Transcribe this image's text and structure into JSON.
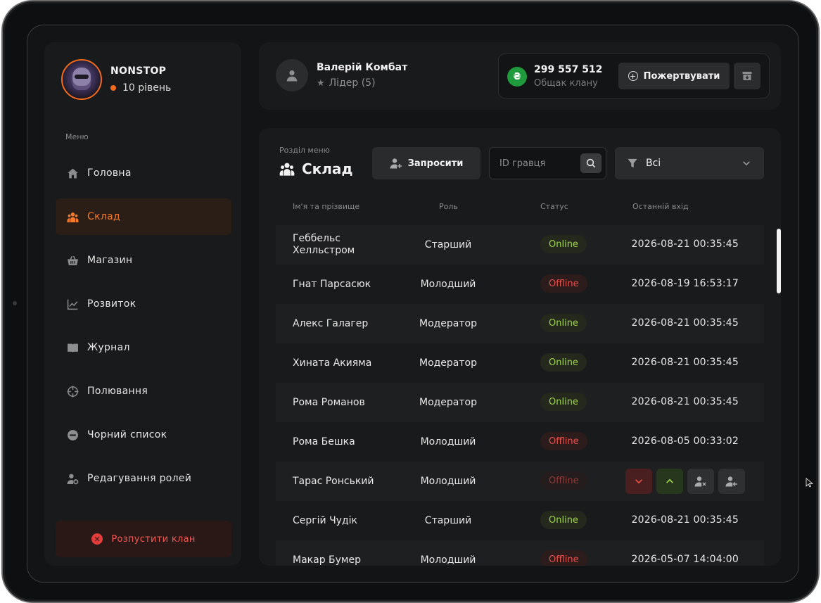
{
  "clan": {
    "name": "NONSTOP",
    "level": "10 рівень"
  },
  "sidebar": {
    "caption": "Меню",
    "items": [
      {
        "label": "Головна",
        "icon": "home-icon",
        "active": false
      },
      {
        "label": "Склад",
        "icon": "team-icon",
        "active": true
      },
      {
        "label": "Магазин",
        "icon": "basket-icon",
        "active": false
      },
      {
        "label": "Розвиток",
        "icon": "chart-line-icon",
        "active": false
      },
      {
        "label": "Журнал",
        "icon": "book-icon",
        "active": false
      },
      {
        "label": "Полювання",
        "icon": "crosshair-icon",
        "active": false
      },
      {
        "label": "Чорний список",
        "icon": "block-icon",
        "active": false
      },
      {
        "label": "Редагування ролей",
        "icon": "user-gear-icon",
        "active": false
      }
    ],
    "disband_label": "Розпустити клан"
  },
  "leader": {
    "name": "Валерій Комбат",
    "role": "Лідер (5)"
  },
  "treasury": {
    "currency_symbol": "₴",
    "amount": "299 557 512",
    "label": "Общак клану",
    "donate_label": "Пожертвувати"
  },
  "section": {
    "caption": "Розділ меню",
    "title": "Склад",
    "invite_label": "Запросити",
    "search_placeholder": "ID гравця",
    "filter_value": "Всі"
  },
  "table": {
    "headers": {
      "name": "Ім'я та прізвище",
      "role": "Роль",
      "status": "Статус",
      "last_login": "Останній вхід"
    },
    "rows": [
      {
        "name": "Геббельс Хелльстром",
        "role": "Старший",
        "status": "Online",
        "last_login": "2026-08-21 00:35:45"
      },
      {
        "name": "Гнат Парсасюк",
        "role": "Молодший",
        "status": "Offline",
        "last_login": "2026-08-19 16:53:17"
      },
      {
        "name": "Алекс Галагер",
        "role": "Модератор",
        "status": "Online",
        "last_login": "2026-08-21 00:35:45"
      },
      {
        "name": "Хината Акияма",
        "role": "Модератор",
        "status": "Online",
        "last_login": "2026-08-21 00:35:45"
      },
      {
        "name": "Рома Романов",
        "role": "Модератор",
        "status": "Online",
        "last_login": "2026-08-21 00:35:45"
      },
      {
        "name": "Рома Бешка",
        "role": "Молодший",
        "status": "Offline",
        "last_login": "2026-08-05 00:33:02"
      },
      {
        "name": "Тарас Ронський",
        "role": "Молодший",
        "status": "Offline",
        "last_login": "",
        "hovered": true
      },
      {
        "name": "Сергій Чудік",
        "role": "Старший",
        "status": "Online",
        "last_login": "2026-08-21 00:35:45"
      },
      {
        "name": "Макар Бумер",
        "role": "Молодший",
        "status": "Offline",
        "last_login": "2026-05-07 14:04:00"
      }
    ]
  },
  "colors": {
    "accent": "#f26b1d",
    "online": "#9ed64a",
    "offline": "#e8514c",
    "coin": "#1f9a3c"
  }
}
